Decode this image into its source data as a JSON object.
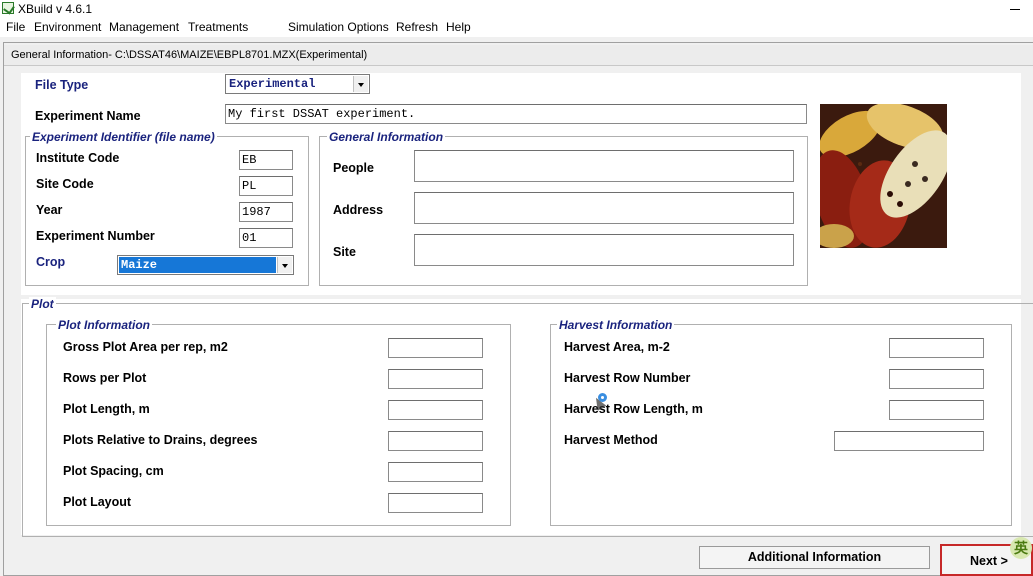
{
  "app": {
    "title": "XBuild v 4.6.1"
  },
  "menu": {
    "items": [
      "File",
      "Environment",
      "Management",
      "Treatments",
      "Simulation Options",
      "Refresh",
      "Help"
    ]
  },
  "window": {
    "caption": "General Information- C:\\DSSAT46\\MAIZE\\EBPL8701.MZX(Experimental)"
  },
  "general": {
    "file_type_label": "File Type",
    "file_type_value": "Experimental",
    "experiment_name_label": "Experiment Name",
    "experiment_name_value": "My first DSSAT experiment."
  },
  "identifier": {
    "legend": "Experiment Identifier (file name)",
    "institute_label": "Institute Code",
    "institute_value": "EB",
    "site_label": "Site Code",
    "site_value": "PL",
    "year_label": "Year",
    "year_value": "1987",
    "number_label": "Experiment Number",
    "number_value": "01",
    "crop_label": "Crop",
    "crop_value": "Maize"
  },
  "general_info": {
    "legend": "General Information",
    "people_label": "People",
    "people_value": "",
    "address_label": "Address",
    "address_value": "",
    "site_label": "Site",
    "site_value": ""
  },
  "plot": {
    "legend": "Plot",
    "info_legend": "Plot Information",
    "fields": [
      "Gross Plot Area per rep, m2",
      "Rows per Plot",
      "Plot Length, m",
      "Plots Relative to Drains, degrees",
      "Plot Spacing, cm",
      "Plot Layout"
    ],
    "harvest_legend": "Harvest Information",
    "harvest_fields": [
      "Harvest Area, m-2",
      "Harvest Row Number",
      "Harvest Row Length, m",
      "Harvest Method"
    ]
  },
  "buttons": {
    "additional": "Additional Information",
    "next": "Next >"
  },
  "ime": {
    "label": "英"
  },
  "colors": {
    "label_blue": "#1a237e",
    "selection_blue": "#1677d7",
    "next_border": "#c62828"
  },
  "icons": [
    "xbuild-app-icon",
    "minimize-icon",
    "dropdown-arrow-icon",
    "mouse-cursor-icon"
  ]
}
